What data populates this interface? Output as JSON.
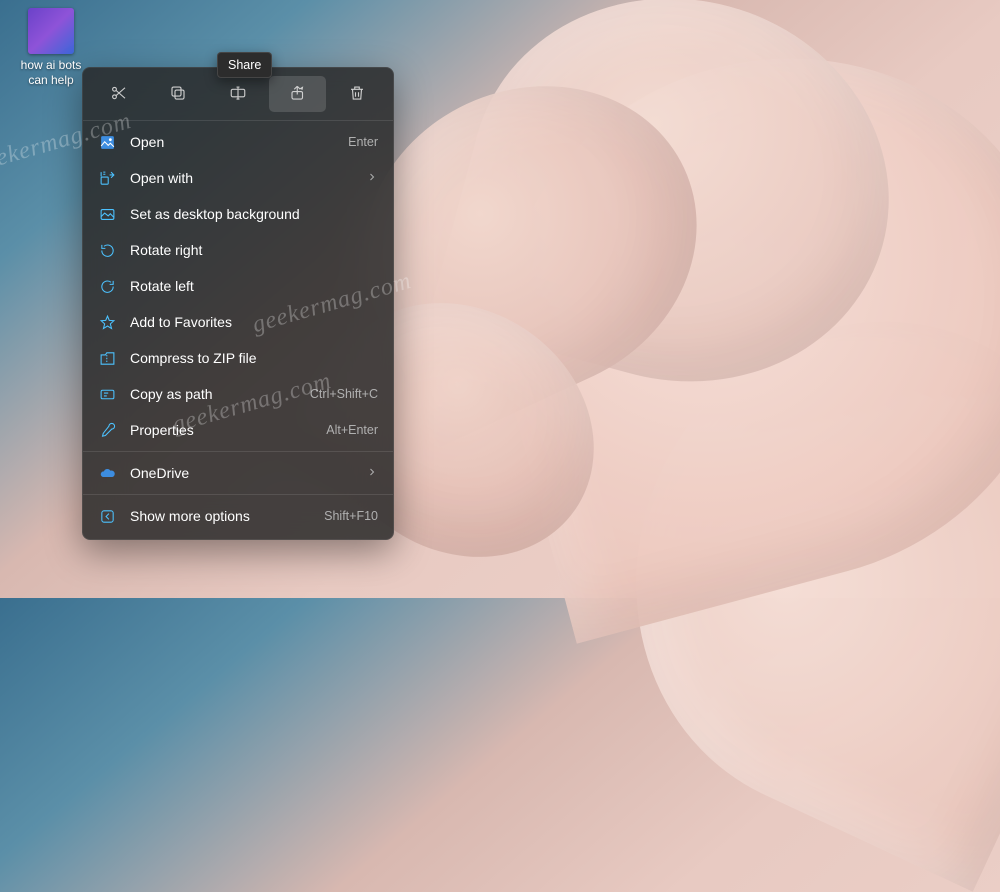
{
  "desktop_icon": {
    "label": "how ai bots can help"
  },
  "tooltip": {
    "text": "Share"
  },
  "quick_actions": {
    "cut": "cut",
    "copy": "copy",
    "rename": "rename",
    "share": "share",
    "delete": "delete"
  },
  "menu": {
    "open": {
      "label": "Open",
      "accel": "Enter"
    },
    "open_with": {
      "label": "Open with"
    },
    "set_bg": {
      "label": "Set as desktop background"
    },
    "rotate_right": {
      "label": "Rotate right"
    },
    "rotate_left": {
      "label": "Rotate left"
    },
    "favorites": {
      "label": "Add to Favorites"
    },
    "compress": {
      "label": "Compress to ZIP file"
    },
    "copy_path": {
      "label": "Copy as path",
      "accel": "Ctrl+Shift+C"
    },
    "properties": {
      "label": "Properties",
      "accel": "Alt+Enter"
    },
    "onedrive": {
      "label": "OneDrive"
    },
    "more": {
      "label": "Show more options",
      "accel": "Shift+F10"
    }
  },
  "watermark": "geekermag.com"
}
